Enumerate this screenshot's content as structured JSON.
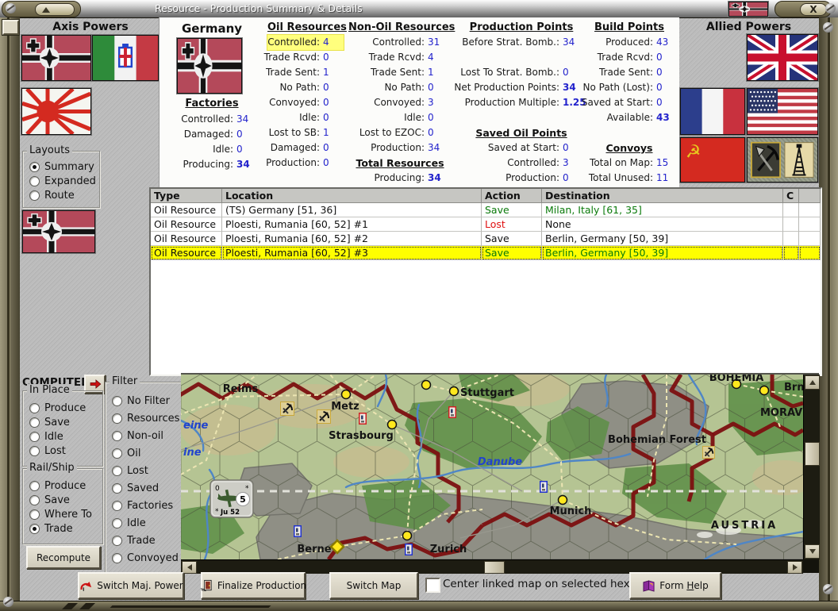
{
  "window": {
    "title": "Resource - Production Summary & Details",
    "close": "X"
  },
  "axis": {
    "title": "Axis Powers",
    "layouts": {
      "title": "Layouts",
      "options": [
        {
          "label": "Summary",
          "sel": "checked",
          "name": "radio-layout-summary"
        },
        {
          "label": "Expanded",
          "name": "radio-layout-expanded"
        },
        {
          "label": "Route",
          "name": "radio-layout-route"
        }
      ]
    }
  },
  "allied": {
    "title": "Allied Powers"
  },
  "stats": {
    "country": "Germany",
    "factories": {
      "header": "Factories",
      "rows": [
        {
          "label": "Controlled:",
          "value": "34"
        },
        {
          "label": "Damaged:",
          "value": "0"
        },
        {
          "label": "Idle:",
          "value": "0"
        },
        {
          "label": "Producing:",
          "value": "34",
          "vcls": "bold"
        }
      ]
    },
    "oil": {
      "header": "Oil Resources",
      "rows": [
        {
          "label": "Controlled:",
          "value": "4",
          "cls": "highlight"
        },
        {
          "label": "Trade Rcvd:",
          "value": "0"
        },
        {
          "label": "Trade Sent:",
          "value": "1"
        },
        {
          "label": "No Path:",
          "value": "0"
        },
        {
          "label": "Convoyed:",
          "value": "0"
        },
        {
          "label": "Idle:",
          "value": "0"
        },
        {
          "label": "Lost to SB:",
          "value": "1"
        },
        {
          "label": "Damaged:",
          "value": "0"
        },
        {
          "label": "Production:",
          "value": "0"
        }
      ]
    },
    "nonoil": {
      "header": "Non-Oil Resources",
      "rows": [
        {
          "label": "Controlled:",
          "value": "31"
        },
        {
          "label": "Trade Rcvd:",
          "value": "4"
        },
        {
          "label": "Trade Sent:",
          "value": "1"
        },
        {
          "label": "No Path:",
          "value": "0"
        },
        {
          "label": "Convoyed:",
          "value": "3"
        },
        {
          "label": "Idle:",
          "value": "0"
        },
        {
          "label": "Lost to EZOC:",
          "value": "0"
        },
        {
          "label": "Production:",
          "value": "34"
        },
        {
          "htext": "Total Resources"
        },
        {
          "label": "Producing:",
          "value": "34",
          "vcls": "bold"
        }
      ]
    },
    "production": {
      "header": "Production Points",
      "rows": [
        {
          "label": "Before Strat. Bomb.:",
          "value": "34"
        },
        {},
        {
          "label": "Lost To Strat. Bomb.:",
          "value": "0"
        },
        {
          "label": "Net Production Points:",
          "value": "34",
          "vcls": "bold"
        },
        {
          "label": "Production Multiple:",
          "value": "1.25",
          "vcls": "bold"
        },
        {},
        {
          "htext": "Saved Oil Points"
        },
        {
          "label": "Saved at Start:",
          "value": "0"
        },
        {
          "label": "Controlled:",
          "value": "3"
        },
        {
          "label": "Production:",
          "value": "0"
        }
      ]
    },
    "build": {
      "header": "Build Points",
      "rows": [
        {
          "label": "Produced:",
          "value": "43"
        },
        {
          "label": "Trade Rcvd:",
          "value": "0"
        },
        {
          "label": "Trade Sent:",
          "value": "0"
        },
        {
          "label": "No Path (Lost):",
          "value": "0"
        },
        {
          "label": "Saved at Start:",
          "value": "0"
        },
        {
          "label": "Available:",
          "value": "43",
          "vcls": "bold"
        },
        {},
        {
          "htext": "Convoys"
        },
        {
          "label": "Total on Map:",
          "value": "15"
        },
        {
          "label": "Total Unused:",
          "value": "11"
        }
      ]
    }
  },
  "table": {
    "headers": [
      "Type",
      "Location",
      "Action",
      "Destination",
      "C"
    ],
    "rows": [
      {
        "type": "Oil Resource",
        "location": "(TS) Germany [51, 36]",
        "action": "Save",
        "action_cls": "green",
        "dest": "Milan, Italy [61, 35]",
        "dest_cls": "green"
      },
      {
        "type": "Oil Resource",
        "location": "Ploesti, Rumania [60, 52] #1",
        "action": "Lost",
        "action_cls": "red",
        "dest": "None"
      },
      {
        "type": "Oil Resource",
        "location": "Ploesti, Rumania [60, 52] #2",
        "action": "Save",
        "dest": "Berlin, Germany [50, 39]"
      },
      {
        "type": "Oil Resource",
        "location": "Ploesti, Rumania [60, 52] #3",
        "action": "Save",
        "action_cls": "green",
        "dest": "Berlin, Germany [50, 39]",
        "dest_cls": "green",
        "row_cls": "selected"
      }
    ]
  },
  "controls": {
    "computed": "COMPUTED",
    "in_place": {
      "title": "In Place",
      "options": [
        {
          "label": "Produce",
          "name": "radio-inplace-produce"
        },
        {
          "label": "Save",
          "name": "radio-inplace-save"
        },
        {
          "label": "Idle",
          "name": "radio-inplace-idle"
        },
        {
          "label": "Lost",
          "name": "radio-inplace-lost"
        }
      ]
    },
    "rail_ship": {
      "title": "Rail/Ship",
      "options": [
        {
          "label": "Produce",
          "name": "radio-railship-produce"
        },
        {
          "label": "Save",
          "name": "radio-railship-save"
        },
        {
          "label": "Where To",
          "name": "radio-railship-whereto"
        },
        {
          "label": "Trade",
          "sel": "checked",
          "name": "radio-railship-trade"
        }
      ]
    },
    "recompute": "Recompute",
    "filter": {
      "title": "Filter",
      "options": [
        {
          "label": "No Filter",
          "name": "radio-filter-no-filter"
        },
        {
          "label": "Resources",
          "name": "radio-filter-resources"
        },
        {
          "label": "Non-oil",
          "name": "radio-filter-non-oil"
        },
        {
          "label": "Oil",
          "name": "radio-filter-oil"
        },
        {
          "label": "Lost",
          "name": "radio-filter-lost"
        },
        {
          "label": "Saved",
          "name": "radio-filter-saved"
        },
        {
          "label": "Factories",
          "name": "radio-filter-factories"
        },
        {
          "label": "Idle",
          "name": "radio-filter-idle"
        },
        {
          "label": "Trade",
          "name": "radio-filter-trade"
        },
        {
          "label": "Convoyed",
          "name": "radio-filter-convoyed"
        }
      ]
    }
  },
  "footer": {
    "switch_power": "Switch Maj. Power",
    "finalize": "Finalize Production",
    "switch_map": "Switch Map",
    "center_label": "Center linked map on selected hex",
    "help_pre": "Form ",
    "help_h": "H",
    "help_rest": "elp"
  },
  "map": {
    "cities": {
      "reims": "Reims",
      "metz": "Metz",
      "strasbourg": "Strasbourg",
      "stuttgart": "Stuttgart",
      "berne": "Berne",
      "zurich": "Zurich",
      "munich": "Munich",
      "brno": "Brno"
    },
    "regions": {
      "bohemian_forest": "Bohemian Forest",
      "austria": "AUSTRIA",
      "moravia": "MORAVIA",
      "bohemia": "BOHEMIA"
    },
    "rivers": {
      "danube": "Danube",
      "seine_fragment": "eine",
      "ine_fragment": "ine"
    },
    "unit": {
      "corner": "0",
      "star": "*",
      "value": "5",
      "name": "Ju 52"
    }
  },
  "colors": {
    "value_blue": "#2323cc",
    "save_green": "#0a7a0a",
    "lost_red": "#e01010",
    "highlight_yellow": "#ffff7d",
    "selected_row_yellow": "#ffff00",
    "border_red": "#7c1010"
  }
}
